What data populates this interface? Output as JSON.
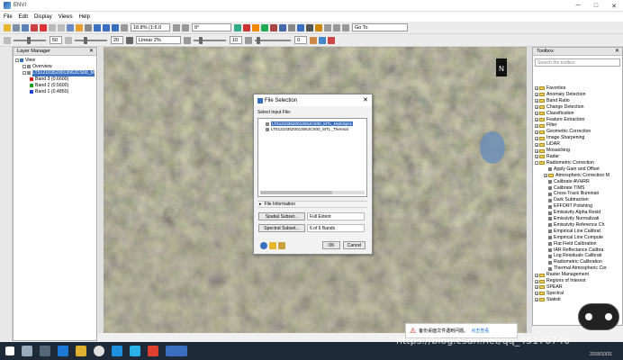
{
  "app": {
    "title": "ENVI"
  },
  "menu": [
    "File",
    "Edit",
    "Display",
    "Views",
    "Help"
  ],
  "toolbar1": {
    "zoom_value": "18.8% (1:6.0",
    "rotation_value": "0°",
    "goto_placeholder": "Go To"
  },
  "toolbar2": {
    "value_a": "50",
    "value_b": "20",
    "stretch_value": "Linear 2%",
    "value_c": "10",
    "value_d": "0"
  },
  "layer_manager": {
    "title": "Layer Manager",
    "items": [
      {
        "label": "View",
        "level": 0
      },
      {
        "label": "Overview",
        "level": 1
      },
      {
        "label": "LT51210352001306JCS00_M",
        "level": 1,
        "selected": true
      },
      {
        "label": "Band 3 (0.6600)",
        "level": 2,
        "color": "#e02020"
      },
      {
        "label": "Band 2 (0.5600)",
        "level": 2,
        "color": "#20a020"
      },
      {
        "label": "Band 1 (0.4850)",
        "level": 2,
        "color": "#2040e0"
      }
    ]
  },
  "toolbox": {
    "title": "Toolbox",
    "search_placeholder": "Search the toolbox",
    "items": [
      {
        "label": "Favorites",
        "type": "folder",
        "level": 0
      },
      {
        "label": "Anomaly Detection",
        "type": "folder",
        "level": 0
      },
      {
        "label": "Band Ratio",
        "type": "folder",
        "level": 0
      },
      {
        "label": "Change Detection",
        "type": "folder",
        "level": 0
      },
      {
        "label": "Classification",
        "type": "folder",
        "level": 0
      },
      {
        "label": "Feature Extraction",
        "type": "folder",
        "level": 0
      },
      {
        "label": "Filter",
        "type": "folder",
        "level": 0
      },
      {
        "label": "Geometric Correction",
        "type": "folder",
        "level": 0
      },
      {
        "label": "Image Sharpening",
        "type": "folder",
        "level": 0
      },
      {
        "label": "LiDAR",
        "type": "folder",
        "level": 0
      },
      {
        "label": "Mosaicking",
        "type": "folder",
        "level": 0
      },
      {
        "label": "Radar",
        "type": "folder",
        "level": 0
      },
      {
        "label": "Radiometric Correction",
        "type": "folder",
        "level": 0,
        "open": true
      },
      {
        "label": "Apply Gain and Offset",
        "type": "tool",
        "level": 1
      },
      {
        "label": "Atmospheric Correction M",
        "type": "folder",
        "level": 1
      },
      {
        "label": "Calibrate AVHRR",
        "type": "tool",
        "level": 1
      },
      {
        "label": "Calibrate TIMS",
        "type": "tool",
        "level": 1
      },
      {
        "label": "Cross-Track Illuminati",
        "type": "tool",
        "level": 1
      },
      {
        "label": "Dark Subtraction",
        "type": "tool",
        "level": 1
      },
      {
        "label": "EFFORT Polishing",
        "type": "tool",
        "level": 1
      },
      {
        "label": "Emissivity Alpha Resid",
        "type": "tool",
        "level": 1
      },
      {
        "label": "Emissivity Normalizati",
        "type": "tool",
        "level": 1
      },
      {
        "label": "Emissivity Reference Ch",
        "type": "tool",
        "level": 1
      },
      {
        "label": "Empirical Line Calibrat",
        "type": "tool",
        "level": 1
      },
      {
        "label": "Empirical Line Compute",
        "type": "tool",
        "level": 1
      },
      {
        "label": "Flat Field Calibration",
        "type": "tool",
        "level": 1
      },
      {
        "label": "IAR Reflectance Calibra",
        "type": "tool",
        "level": 1
      },
      {
        "label": "Log Residuals Calibrati",
        "type": "tool",
        "level": 1
      },
      {
        "label": "Radiometric Calibration",
        "type": "tool",
        "level": 1
      },
      {
        "label": "Thermal Atmospheric Cor",
        "type": "tool",
        "level": 1
      },
      {
        "label": "Raster Management",
        "type": "folder",
        "level": 0
      },
      {
        "label": "Regions of Interest",
        "type": "folder",
        "level": 0
      },
      {
        "label": "SPEAR",
        "type": "folder",
        "level": 0
      },
      {
        "label": "Spectral",
        "type": "folder",
        "level": 0
      },
      {
        "label": "Statisti",
        "type": "folder",
        "level": 0
      }
    ]
  },
  "dialog": {
    "title": "File Selection",
    "section_label": "Select Input File:",
    "files": [
      {
        "label": "LT51210352001306JCS00_MTL_MultiSpec",
        "selected": true
      },
      {
        "label": "LT51210352001306JCS00_MTL_Thermal",
        "selected": false
      }
    ],
    "file_info_label": "File Information",
    "spatial_subset_label": "Spatial Subset...",
    "spatial_subset_value": "Full Extent",
    "spectral_subset_label": "Spectral Subset...",
    "spectral_subset_value": "6 of 6 Bands",
    "ok_label": "OK",
    "cancel_label": "Cancel"
  },
  "notification": {
    "text": "备份桌面文件遇到问题。",
    "link": "点击查看"
  },
  "taskbar": {
    "time": "",
    "date": "2018/10/31"
  },
  "watermark": "https://blog.csdn.net/qq_45176746",
  "north_label": "N"
}
